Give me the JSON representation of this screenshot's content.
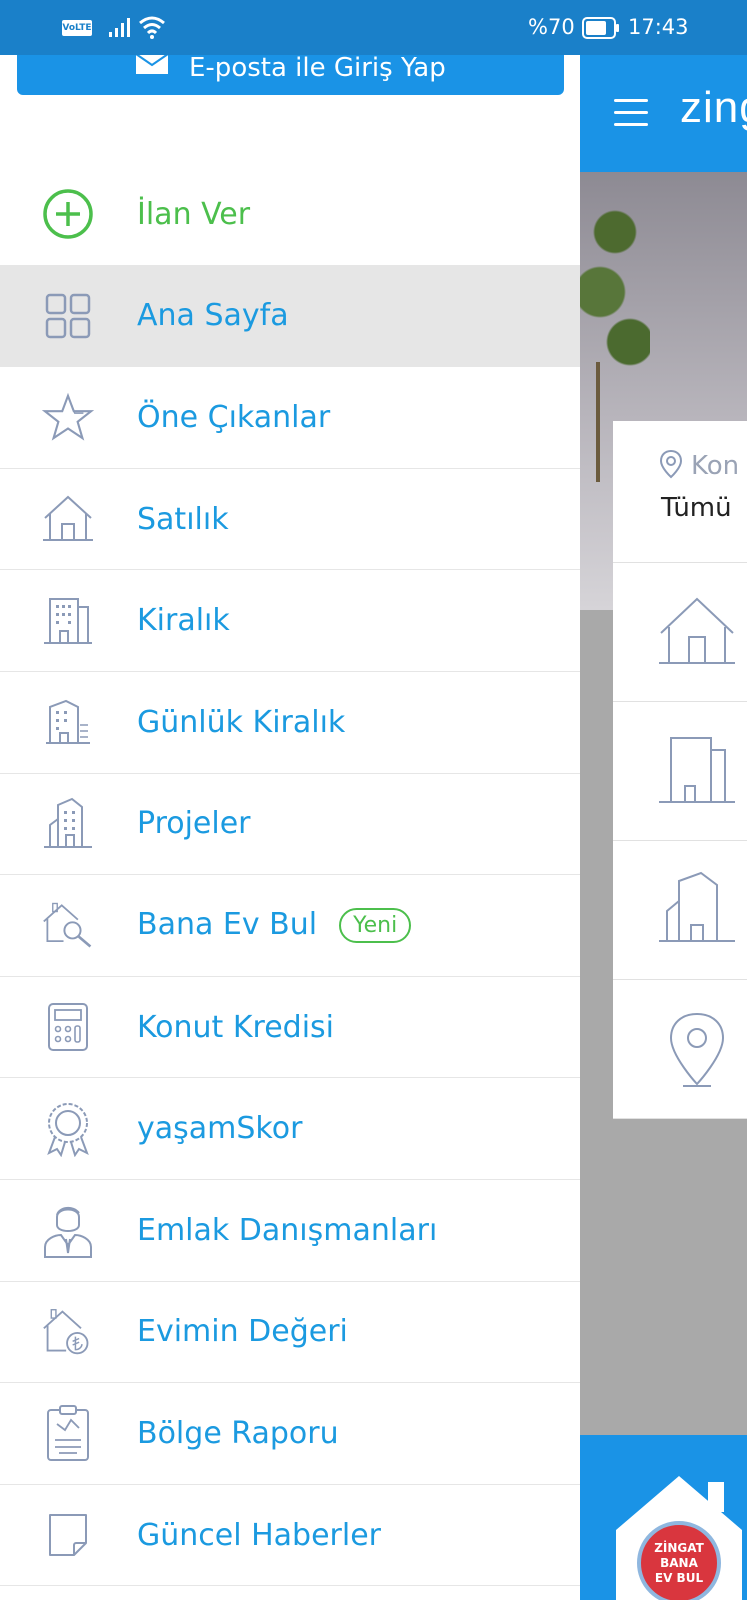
{
  "status_bar": {
    "volte": "VoLTE",
    "battery_percent": "%70",
    "time": "17:43"
  },
  "drawer": {
    "login_button": "E-posta ile Giriş Yap",
    "menu": [
      {
        "label": "İlan Ver",
        "icon": "plus-circle-icon"
      },
      {
        "label": "Ana Sayfa",
        "icon": "grid-icon",
        "active": true
      },
      {
        "label": "Öne Çıkanlar",
        "icon": "star-icon"
      },
      {
        "label": "Satılık",
        "icon": "house-icon"
      },
      {
        "label": "Kiralık",
        "icon": "building-icon"
      },
      {
        "label": "Günlük Kiralık",
        "icon": "daily-building-icon"
      },
      {
        "label": "Projeler",
        "icon": "tower-icon"
      },
      {
        "label": "Bana Ev Bul",
        "icon": "house-search-icon",
        "badge": "Yeni"
      },
      {
        "label": "Konut Kredisi",
        "icon": "calculator-icon"
      },
      {
        "label": "yaşamSkor",
        "icon": "award-icon"
      },
      {
        "label": "Emlak Danışmanları",
        "icon": "agent-icon"
      },
      {
        "label": "Evimin Değeri",
        "icon": "house-lira-icon"
      },
      {
        "label": "Bölge Raporu",
        "icon": "report-icon"
      },
      {
        "label": "Güncel Haberler",
        "icon": "news-icon"
      }
    ]
  },
  "background_app": {
    "logo": "zing",
    "location_label": "Kon",
    "location_value": "Tümü",
    "bottom_badge": [
      "ZİNGAT",
      "BANA",
      "EV BUL"
    ]
  },
  "colors": {
    "primary_blue": "#1a93e6",
    "status_blue": "#1a80c9",
    "label_blue": "#1b9ae0",
    "green": "#4cbf4c",
    "icon_gray": "#8b9ab7"
  }
}
